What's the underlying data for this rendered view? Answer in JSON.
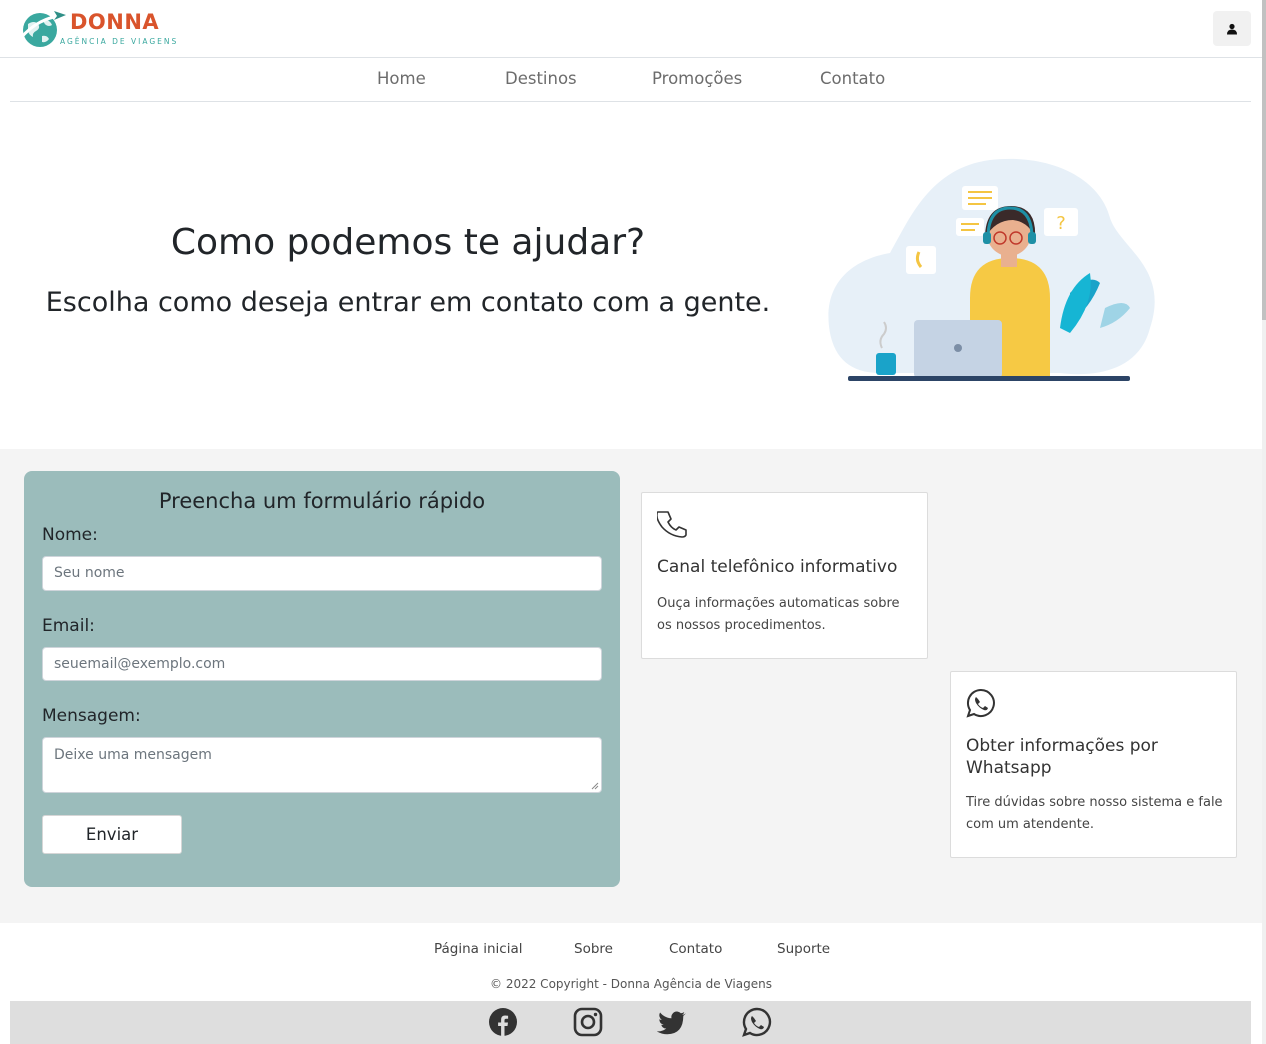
{
  "brand": {
    "name": "DONNA",
    "tagline": "AGÊNCIA DE VIAGENS"
  },
  "nav": {
    "items": [
      "Home",
      "Destinos",
      "Promoções",
      "Contato"
    ]
  },
  "hero": {
    "title": "Como podemos te ajudar?",
    "subtitle": "Escolha como deseja entrar em contato com a gente."
  },
  "form": {
    "title": "Preencha um formulário rápido",
    "name_label": "Nome:",
    "name_placeholder": "Seu nome",
    "email_label": "Email:",
    "email_placeholder": "seuemail@exemplo.com",
    "message_label": "Mensagem:",
    "message_placeholder": "Deixe uma mensagem",
    "submit_label": "Enviar"
  },
  "cards": {
    "phone": {
      "title": "Canal telefônico informativo",
      "text": "Ouça informações automaticas sobre os nossos procedimentos.",
      "icon": "phone-icon"
    },
    "whatsapp": {
      "title": "Obter informações por Whatsapp",
      "text": "Tire dúvidas sobre nosso sistema e fale com um atendente.",
      "icon": "whatsapp-icon"
    }
  },
  "footer": {
    "links": [
      "Página inicial",
      "Sobre",
      "Contato",
      "Suporte"
    ],
    "copyright": "© 2022 Copyright - Donna Agência de Viagens",
    "social": [
      "facebook-icon",
      "instagram-icon",
      "twitter-icon",
      "whatsapp-icon"
    ]
  },
  "colors": {
    "brand_orange": "#d9542c",
    "brand_teal": "#3aa89f",
    "form_bg": "#9bbcbb",
    "section_bg": "#f4f4f4"
  }
}
